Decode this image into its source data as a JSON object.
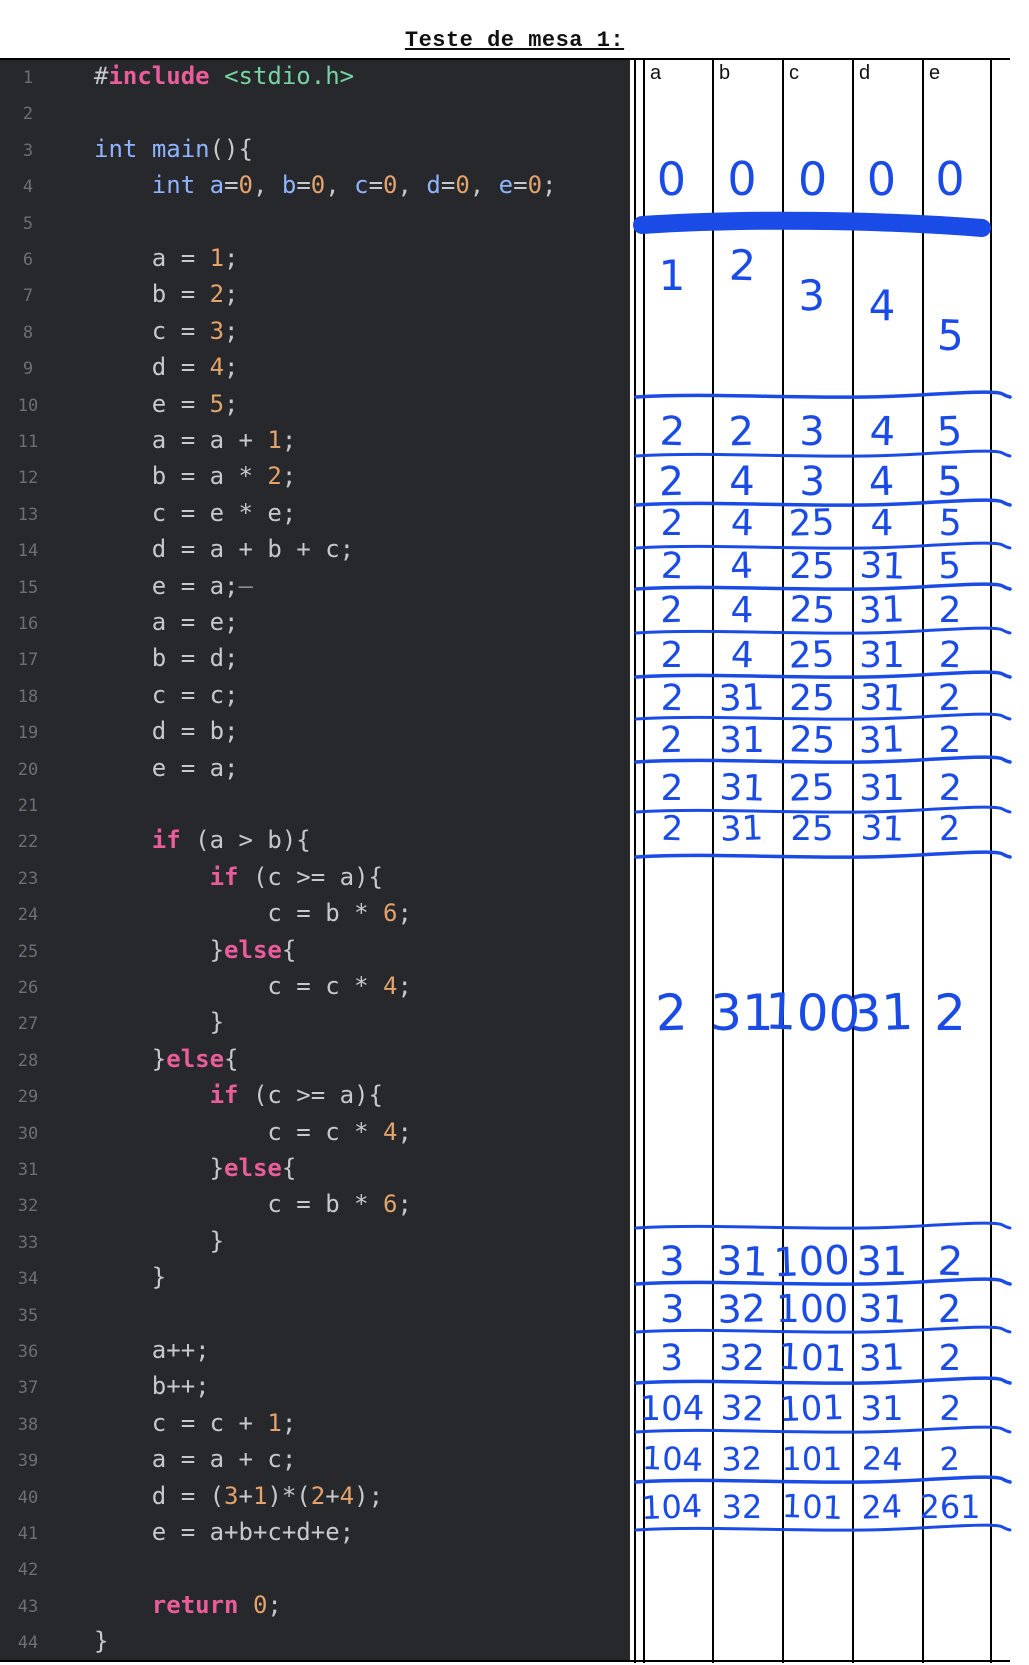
{
  "title": "Teste de mesa 1:",
  "columns": [
    "a",
    "b",
    "c",
    "d",
    "e"
  ],
  "code_lines": [
    {
      "n": "1",
      "html": "#<span class='kw'>include</span> <span class='str'>&lt;stdio.h&gt;</span>"
    },
    {
      "n": "2",
      "html": ""
    },
    {
      "n": "3",
      "html": "<span class='ty'>int</span> <span class='ty'>main</span>(){"
    },
    {
      "n": "4",
      "html": "    <span class='ty'>int</span> <span class='ty'>a</span>=<span class='num'>0</span>, <span class='ty'>b</span>=<span class='num'>0</span>, <span class='ty'>c</span>=<span class='num'>0</span>, <span class='ty'>d</span>=<span class='num'>0</span>, <span class='ty'>e</span>=<span class='num'>0</span>;"
    },
    {
      "n": "5",
      "html": ""
    },
    {
      "n": "6",
      "html": "    a = <span class='num'>1</span>;"
    },
    {
      "n": "7",
      "html": "    b = <span class='num'>2</span>;"
    },
    {
      "n": "8",
      "html": "    c = <span class='num'>3</span>;"
    },
    {
      "n": "9",
      "html": "    d = <span class='num'>4</span>;"
    },
    {
      "n": "10",
      "html": "    e = <span class='num'>5</span>;"
    },
    {
      "n": "11",
      "html": "    a = a + <span class='num'>1</span>;"
    },
    {
      "n": "12",
      "html": "    b = a * <span class='num'>2</span>;"
    },
    {
      "n": "13",
      "html": "    c = e * e;"
    },
    {
      "n": "14",
      "html": "    d = a + b + c;"
    },
    {
      "n": "15",
      "html": "    e = a;<span class='faint'>—</span>"
    },
    {
      "n": "16",
      "html": "    a = e;"
    },
    {
      "n": "17",
      "html": "    b = d;"
    },
    {
      "n": "18",
      "html": "    c = c;"
    },
    {
      "n": "19",
      "html": "    d = b;"
    },
    {
      "n": "20",
      "html": "    e = a;"
    },
    {
      "n": "21",
      "html": ""
    },
    {
      "n": "22",
      "html": "    <span class='kw'>if</span> (a &gt; b){"
    },
    {
      "n": "23",
      "html": "        <span class='kw'>if</span> (c &gt;= a){"
    },
    {
      "n": "24",
      "html": "            c = b * <span class='num'>6</span>;"
    },
    {
      "n": "25",
      "html": "        }<span class='kw'>else</span>{"
    },
    {
      "n": "26",
      "html": "            c = c * <span class='num'>4</span>;"
    },
    {
      "n": "27",
      "html": "        }"
    },
    {
      "n": "28",
      "html": "    }<span class='kw'>else</span>{"
    },
    {
      "n": "29",
      "html": "        <span class='kw'>if</span> (c &gt;= a){"
    },
    {
      "n": "30",
      "html": "            c = c * <span class='num'>4</span>;"
    },
    {
      "n": "31",
      "html": "        }<span class='kw'>else</span>{"
    },
    {
      "n": "32",
      "html": "            c = b * <span class='num'>6</span>;"
    },
    {
      "n": "33",
      "html": "        }"
    },
    {
      "n": "34",
      "html": "    }"
    },
    {
      "n": "35",
      "html": ""
    },
    {
      "n": "36",
      "html": "    a++;"
    },
    {
      "n": "37",
      "html": "    b++;"
    },
    {
      "n": "38",
      "html": "    c = c + <span class='num'>1</span>;"
    },
    {
      "n": "39",
      "html": "    a = a + c;"
    },
    {
      "n": "40",
      "html": "    d = (<span class='num'>3</span>+<span class='num'>1</span>)*(<span class='num'>2</span>+<span class='num'>4</span>);"
    },
    {
      "n": "41",
      "html": "    e = a+b+c+d+e;"
    },
    {
      "n": "42",
      "html": ""
    },
    {
      "n": "43",
      "html": "    <span class='kw'>return</span> <span class='num'>0</span>;"
    },
    {
      "n": "44",
      "html": "}"
    }
  ],
  "handwritten_rows": [
    [
      "0",
      "0",
      "0",
      "0",
      "0"
    ],
    [
      "1",
      "2",
      "3",
      "4",
      "5"
    ],
    [
      "2",
      "2",
      "3",
      "4",
      "5"
    ],
    [
      "2",
      "4",
      "3",
      "4",
      "5"
    ],
    [
      "2",
      "4",
      "25",
      "4",
      "5"
    ],
    [
      "2",
      "4",
      "25",
      "31",
      "5"
    ],
    [
      "2",
      "4",
      "25",
      "31",
      "2"
    ],
    [
      "2",
      "4",
      "25",
      "31",
      "2"
    ],
    [
      "2",
      "31",
      "25",
      "31",
      "2"
    ],
    [
      "2",
      "31",
      "25",
      "31",
      "2"
    ],
    [
      "2",
      "31",
      "25",
      "31",
      "2"
    ],
    [
      "2",
      "31",
      "25",
      "31",
      "2"
    ],
    [
      "2",
      "31",
      "100",
      "31",
      "2"
    ],
    [
      "3",
      "31",
      "100",
      "31",
      "2"
    ],
    [
      "3",
      "32",
      "100",
      "31",
      "2"
    ],
    [
      "3",
      "32",
      "101",
      "31",
      "2"
    ],
    [
      "104",
      "32",
      "101",
      "31",
      "2"
    ],
    [
      "104",
      "32",
      "101",
      "24",
      "2"
    ],
    [
      "104",
      "32",
      "101",
      "24",
      "261"
    ]
  ],
  "colors": {
    "editor_bg": "#27282c",
    "ink": "#1a4be6"
  }
}
